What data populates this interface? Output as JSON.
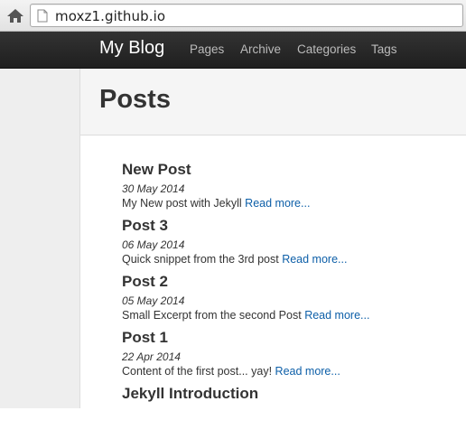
{
  "browser": {
    "url": "moxz1.github.io",
    "home_icon": "home-icon",
    "page_icon": "page-icon"
  },
  "navbar": {
    "brand": "My Blog",
    "items": [
      {
        "label": "Pages"
      },
      {
        "label": "Archive"
      },
      {
        "label": "Categories"
      },
      {
        "label": "Tags"
      }
    ]
  },
  "header": {
    "title": "Posts"
  },
  "posts": [
    {
      "title": "New Post",
      "date": "30 May 2014",
      "excerpt": "My New post with Jekyll",
      "read_more": "Read more..."
    },
    {
      "title": "Post 3",
      "date": "06 May 2014",
      "excerpt": "Quick snippet from the 3rd post",
      "read_more": "Read more..."
    },
    {
      "title": "Post 2",
      "date": "05 May 2014",
      "excerpt": "Small Excerpt from the second Post",
      "read_more": "Read more..."
    },
    {
      "title": "Post 1",
      "date": "22 Apr 2014",
      "excerpt": "Content of the first post... yay!",
      "read_more": "Read more..."
    },
    {
      "title": "Jekyll Introduction"
    }
  ],
  "colors": {
    "navbar": "#222222",
    "link": "#0d5fa8",
    "text": "#333333"
  }
}
